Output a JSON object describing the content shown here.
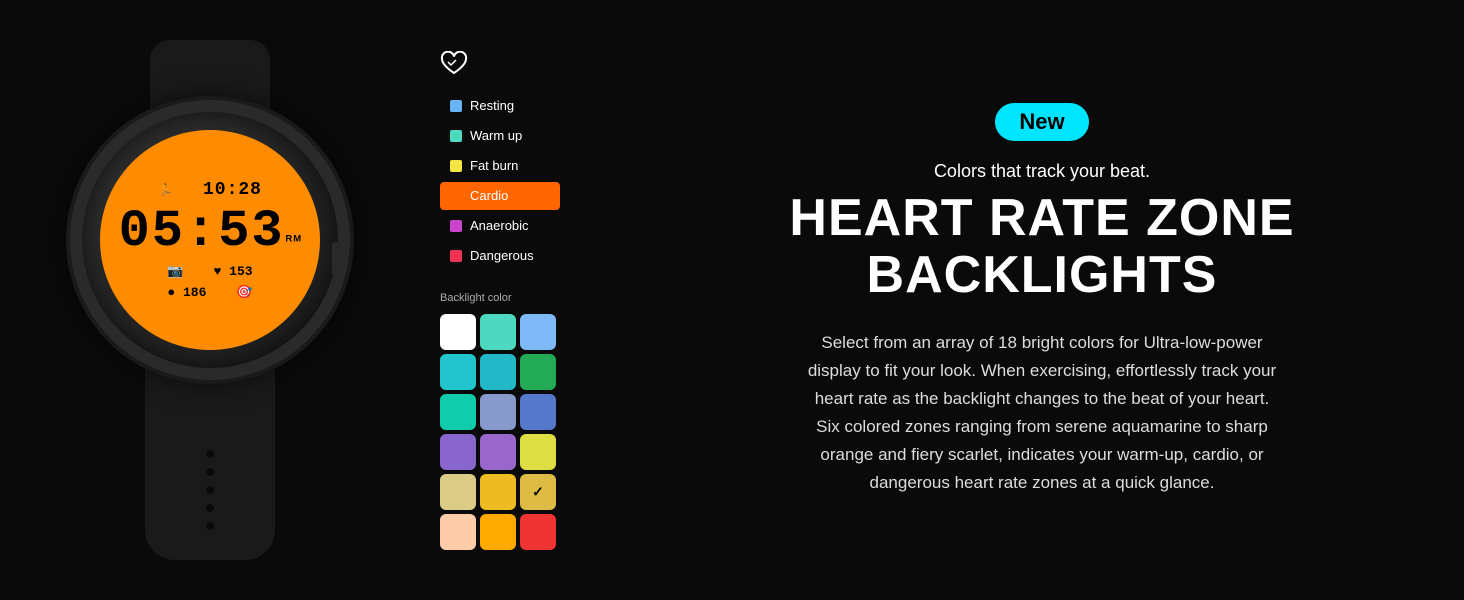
{
  "badge": {
    "label": "New"
  },
  "subtitle": "Colors that track your beat.",
  "main_title_line1": "HEART RATE ZONE",
  "main_title_line2": "BACKLIGHTS",
  "description": "Select from an array of 18 bright colors for Ultra-low-power display to fit your look. When exercising, effortlessly track your heart rate as the backlight changes to the beat of your heart. Six colored zones ranging from serene aquamarine to sharp orange and fiery scarlet, indicates your warm-up, cardio, or dangerous heart rate zones at a quick glance.",
  "zones": [
    {
      "label": "Resting",
      "color": "#6ab4f5",
      "active": false
    },
    {
      "label": "Warm up",
      "color": "#4dd9c0",
      "active": false
    },
    {
      "label": "Fat burn",
      "color": "#f5e642",
      "active": false
    },
    {
      "label": "Cardio",
      "color": "#ff6600",
      "active": true
    },
    {
      "label": "Anaerobic",
      "color": "#cc44cc",
      "active": false
    },
    {
      "label": "Dangerous",
      "color": "#ee3355",
      "active": false
    }
  ],
  "palette_label": "Backlight color",
  "palette_colors": [
    "#ffffff",
    "#4dd9c0",
    "#7eb8f7",
    "#22c5cc",
    "#22b8c8",
    "#22aa55",
    "#11ccaa",
    "#8899cc",
    "#5577cc",
    "#8866cc",
    "#9966cc",
    "#dddd44",
    "#ddcc88",
    "#eebb22",
    "#ddbb44",
    "#ffccaa",
    "#ffaa00",
    "#ee3333"
  ],
  "checked_color_index": 14,
  "watch": {
    "time_small": "10:28",
    "time_large": "05:53",
    "seconds": "ᴿᴹ",
    "stat1": "♥ 153",
    "stat2": "186",
    "stat3": "🎯"
  }
}
